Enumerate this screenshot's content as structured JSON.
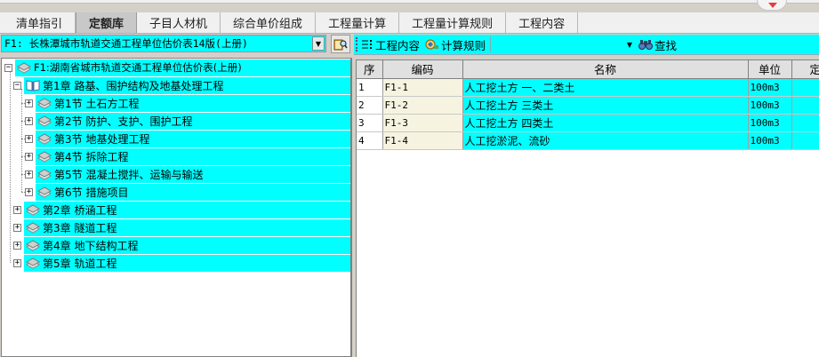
{
  "tabs": [
    {
      "label": "清单指引",
      "active": false
    },
    {
      "label": "定额库",
      "active": true
    },
    {
      "label": "子目人材机",
      "active": false
    },
    {
      "label": "综合单价组成",
      "active": false
    },
    {
      "label": "工程量计算",
      "active": false
    },
    {
      "label": "工程量计算规则",
      "active": false
    },
    {
      "label": "工程内容",
      "active": false
    }
  ],
  "library": {
    "selected": "F1: 长株潭城市轨道交通工程单位估价表14版(上册)"
  },
  "tree": {
    "root": "F1:湖南省城市轨道交通工程单位估价表(上册)",
    "chapter1": "第1章 路基、围护结构及地基处理工程",
    "sections": [
      "第1节 土石方工程",
      "第2节 防护、支护、围护工程",
      "第3节 地基处理工程",
      "第4节 拆除工程",
      "第5节 混凝土搅拌、运输与输送",
      "第6节 措施项目"
    ],
    "chapters": [
      "第2章 桥涵工程",
      "第3章 隧道工程",
      "第4章 地下结构工程",
      "第5章 轨道工程"
    ]
  },
  "toolbar": {
    "work_content": "工程内容",
    "calc_rule": "计算规则",
    "search_value": "",
    "find": "查找"
  },
  "grid": {
    "headers": [
      "序",
      "编码",
      "名称",
      "单位",
      "定"
    ],
    "rows": [
      {
        "seq": "1",
        "code": "F1-1",
        "name": "人工挖土方 一、二类土",
        "unit": "100m3",
        "fixed": ""
      },
      {
        "seq": "2",
        "code": "F1-2",
        "name": "人工挖土方 三类土",
        "unit": "100m3",
        "fixed": ""
      },
      {
        "seq": "3",
        "code": "F1-3",
        "name": "人工挖土方 四类土",
        "unit": "100m3",
        "fixed": ""
      },
      {
        "seq": "4",
        "code": "F1-4",
        "name": "人工挖淤泥、流砂",
        "unit": "100m3",
        "fixed": ""
      }
    ]
  },
  "colors": {
    "highlight": "#00ffff",
    "frame": "#d4d0c8",
    "code_cell": "#f6f3e0"
  }
}
